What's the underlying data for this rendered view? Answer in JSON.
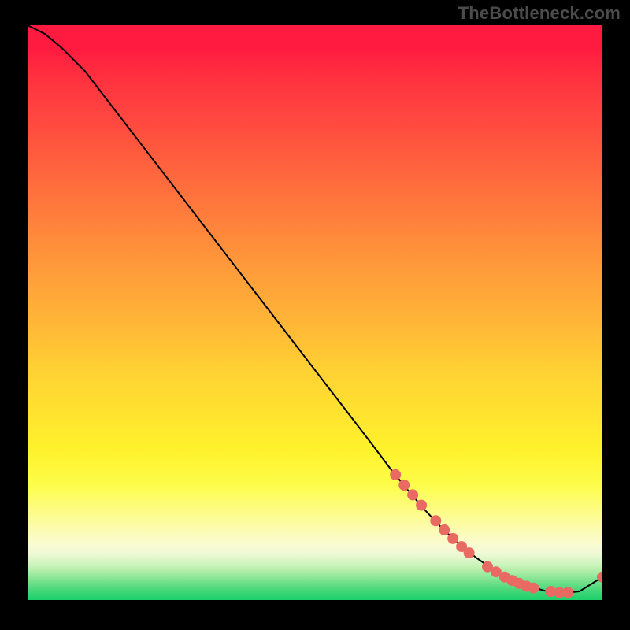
{
  "watermark": "TheBottleneck.com",
  "chart_data": {
    "type": "line",
    "title": "",
    "xlabel": "",
    "ylabel": "",
    "xlim": [
      0,
      100
    ],
    "ylim": [
      0,
      100
    ],
    "gradient_bands": [
      {
        "stop": 0,
        "color": "#ff1a3f"
      },
      {
        "stop": 50,
        "color": "#ffb637"
      },
      {
        "stop": 80,
        "color": "#fdfd4a"
      },
      {
        "stop": 92,
        "color": "#eef9d6"
      },
      {
        "stop": 100,
        "color": "#1bd06a"
      }
    ],
    "series": [
      {
        "name": "bottleneck-curve",
        "x": [
          0,
          3,
          6,
          10,
          15,
          20,
          25,
          30,
          35,
          40,
          45,
          50,
          55,
          60,
          63,
          66,
          69,
          72,
          75,
          78,
          81,
          84,
          87,
          90,
          93,
          96,
          100
        ],
        "y": [
          100,
          98.5,
          96,
          92,
          85.5,
          79,
          72.5,
          66,
          59.5,
          53,
          46.5,
          40,
          33.5,
          27,
          23,
          19.3,
          15.8,
          12.6,
          9.8,
          7.4,
          5.3,
          3.7,
          2.5,
          1.6,
          1.2,
          1.5,
          4
        ]
      }
    ],
    "markers": {
      "name": "highlighted-points",
      "color": "#e86a63",
      "points": [
        {
          "x": 64,
          "y": 21.8
        },
        {
          "x": 65.5,
          "y": 20
        },
        {
          "x": 67,
          "y": 18.3
        },
        {
          "x": 68.5,
          "y": 16.5
        },
        {
          "x": 71,
          "y": 13.8
        },
        {
          "x": 72.5,
          "y": 12.2
        },
        {
          "x": 74,
          "y": 10.7
        },
        {
          "x": 75.5,
          "y": 9.3
        },
        {
          "x": 76.8,
          "y": 8.2
        },
        {
          "x": 80,
          "y": 5.8
        },
        {
          "x": 81.5,
          "y": 4.9
        },
        {
          "x": 83,
          "y": 4
        },
        {
          "x": 84.3,
          "y": 3.4
        },
        {
          "x": 85.5,
          "y": 2.9
        },
        {
          "x": 86.8,
          "y": 2.4
        },
        {
          "x": 88,
          "y": 2.1
        },
        {
          "x": 91,
          "y": 1.5
        },
        {
          "x": 92.5,
          "y": 1.3
        },
        {
          "x": 94,
          "y": 1.3
        },
        {
          "x": 100,
          "y": 4
        }
      ]
    }
  }
}
